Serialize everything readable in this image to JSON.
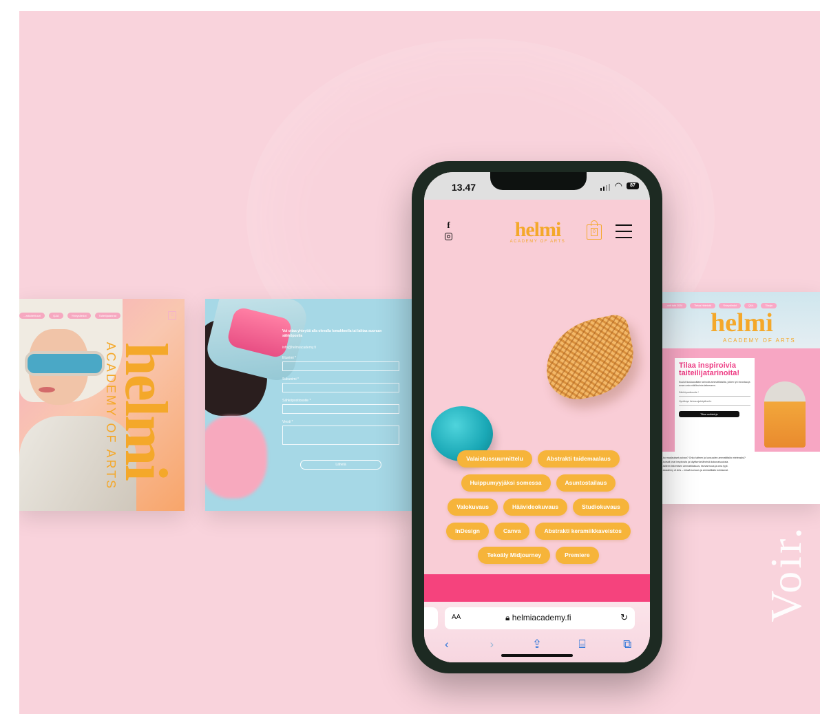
{
  "brand": {
    "name": "helmi",
    "subtitle": "ACADEMY OF ARTS"
  },
  "phone": {
    "status": {
      "time": "13.47",
      "battery": "87"
    },
    "social": {
      "facebook": "f"
    },
    "cart_count": "0",
    "tags": [
      [
        "Valaistussuunnittelu",
        "Abstrakti taidemaalaus"
      ],
      [
        "Huippumyyjäksi somessa",
        "Asuntostailaus"
      ],
      [
        "Valokuvaus",
        "Häävideokuvaus",
        "Studiokuvaus"
      ],
      [
        "InDesign",
        "Canva",
        "Abstrakti keramiikkaveistos"
      ],
      [
        "Tekoäly Midjourney",
        "Premiere"
      ]
    ],
    "browser": {
      "text_size": "AA",
      "url": "helmiacademy.fi",
      "reload": "↻"
    },
    "nav": {
      "back": "‹",
      "forward": "›",
      "share": "⇪",
      "bookmarks": "⌸",
      "tabs": "⧉"
    }
  },
  "left_card": {
    "nav": [
      "...arkkitehtuuri",
      "Q&A",
      "Yhteystiedot",
      "Taiteilijatarinat"
    ],
    "cart_count": "0"
  },
  "mid_card": {
    "intro": "Voi ottaa yhteyttä alla olevalla lomakkeella tai laittaa suoraan sähköpostia",
    "email": "info@helmiacademy.fi",
    "fields": [
      "Etunimi *",
      "Sukunimi *",
      "Sähköpostiosoite *",
      "Viesti *"
    ],
    "submit": "Lähetä"
  },
  "right_card": {
    "pills": [
      "...unti talvi 2024",
      "Tietoa Helmistä",
      "Yhteystiedot",
      "Q&A",
      "Tilaaja"
    ],
    "headline": "Tilaa inspiroivia taiteilijatarinoita!",
    "body": "Kuuluit kuukausittain tarinoita ammattilaisilta, joiden työ innostaa ja avaa uusia näkökulmia taiteeseen.",
    "input1": "Sähköpostiosoite *",
    "input2": "Hyväksyn tietosuojakäytännön",
    "button": "Tilaa uutiskirje",
    "copy": [
      "...ko maalaukset paivan? Onko taiteen ja luovuuden ammattitaito mielessäsi?",
      "...kurssit ovat inspiroivia ja käytännönläheisiä kokonaisuuksia.",
      "...taiteen tekemisen ammattilaisuus, itsevarmuus ja oma tyyli.",
      "...Academy of Arts – missä luovuus ja ammattitaito kohtaavat."
    ]
  },
  "decor": {
    "word": "Voir."
  }
}
